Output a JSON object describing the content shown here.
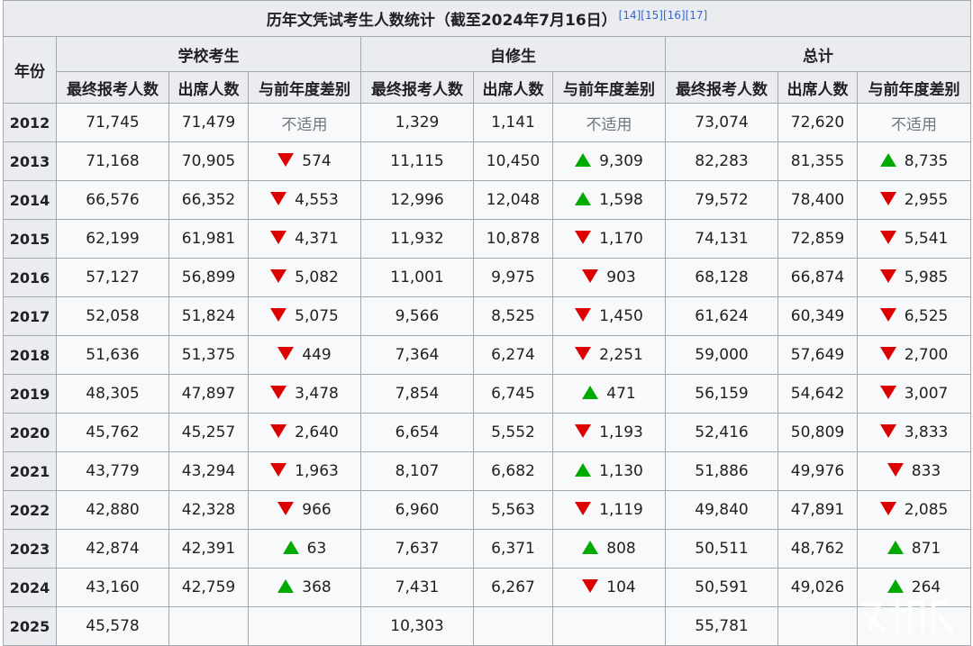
{
  "table": {
    "title": "历年文凭试考生人数统计（截至2024年7月16日）",
    "refs": [
      "[14]",
      "[15]",
      "[16]",
      "[17]"
    ],
    "year_header": "年份",
    "groups": [
      "学校考生",
      "自修生",
      "总计"
    ],
    "subheaders": [
      "最终报考人数",
      "出席人数",
      "与前年度差别"
    ],
    "na_label": "不适用",
    "rows": [
      {
        "year": "2012",
        "cells": [
          {
            "v": "71,745"
          },
          {
            "v": "71,479"
          },
          {
            "na": true
          },
          {
            "v": "1,329"
          },
          {
            "v": "1,141"
          },
          {
            "na": true
          },
          {
            "v": "73,074"
          },
          {
            "v": "72,620"
          },
          {
            "na": true
          }
        ]
      },
      {
        "year": "2013",
        "cells": [
          {
            "v": "71,168"
          },
          {
            "v": "70,905"
          },
          {
            "v": "574",
            "dir": "down"
          },
          {
            "v": "11,115"
          },
          {
            "v": "10,450"
          },
          {
            "v": "9,309",
            "dir": "up"
          },
          {
            "v": "82,283"
          },
          {
            "v": "81,355"
          },
          {
            "v": "8,735",
            "dir": "up"
          }
        ]
      },
      {
        "year": "2014",
        "cells": [
          {
            "v": "66,576"
          },
          {
            "v": "66,352"
          },
          {
            "v": "4,553",
            "dir": "down"
          },
          {
            "v": "12,996"
          },
          {
            "v": "12,048"
          },
          {
            "v": "1,598",
            "dir": "up"
          },
          {
            "v": "79,572"
          },
          {
            "v": "78,400"
          },
          {
            "v": "2,955",
            "dir": "down"
          }
        ]
      },
      {
        "year": "2015",
        "cells": [
          {
            "v": "62,199"
          },
          {
            "v": "61,981"
          },
          {
            "v": "4,371",
            "dir": "down"
          },
          {
            "v": "11,932"
          },
          {
            "v": "10,878"
          },
          {
            "v": "1,170",
            "dir": "down"
          },
          {
            "v": "74,131"
          },
          {
            "v": "72,859"
          },
          {
            "v": "5,541",
            "dir": "down"
          }
        ]
      },
      {
        "year": "2016",
        "cells": [
          {
            "v": "57,127"
          },
          {
            "v": "56,899"
          },
          {
            "v": "5,082",
            "dir": "down"
          },
          {
            "v": "11,001"
          },
          {
            "v": "9,975"
          },
          {
            "v": "903",
            "dir": "down"
          },
          {
            "v": "68,128"
          },
          {
            "v": "66,874"
          },
          {
            "v": "5,985",
            "dir": "down"
          }
        ]
      },
      {
        "year": "2017",
        "cells": [
          {
            "v": "52,058"
          },
          {
            "v": "51,824"
          },
          {
            "v": "5,075",
            "dir": "down"
          },
          {
            "v": "9,566"
          },
          {
            "v": "8,525"
          },
          {
            "v": "1,450",
            "dir": "down"
          },
          {
            "v": "61,624"
          },
          {
            "v": "60,349"
          },
          {
            "v": "6,525",
            "dir": "down"
          }
        ]
      },
      {
        "year": "2018",
        "cells": [
          {
            "v": "51,636"
          },
          {
            "v": "51,375"
          },
          {
            "v": "449",
            "dir": "down"
          },
          {
            "v": "7,364"
          },
          {
            "v": "6,274"
          },
          {
            "v": "2,251",
            "dir": "down"
          },
          {
            "v": "59,000"
          },
          {
            "v": "57,649"
          },
          {
            "v": "2,700",
            "dir": "down"
          }
        ]
      },
      {
        "year": "2019",
        "cells": [
          {
            "v": "48,305"
          },
          {
            "v": "47,897"
          },
          {
            "v": "3,478",
            "dir": "down"
          },
          {
            "v": "7,854"
          },
          {
            "v": "6,745"
          },
          {
            "v": "471",
            "dir": "up"
          },
          {
            "v": "56,159"
          },
          {
            "v": "54,642"
          },
          {
            "v": "3,007",
            "dir": "down"
          }
        ]
      },
      {
        "year": "2020",
        "cells": [
          {
            "v": "45,762"
          },
          {
            "v": "45,257"
          },
          {
            "v": "2,640",
            "dir": "down"
          },
          {
            "v": "6,654"
          },
          {
            "v": "5,552"
          },
          {
            "v": "1,193",
            "dir": "down"
          },
          {
            "v": "52,416"
          },
          {
            "v": "50,809"
          },
          {
            "v": "3,833",
            "dir": "down"
          }
        ]
      },
      {
        "year": "2021",
        "cells": [
          {
            "v": "43,779"
          },
          {
            "v": "43,294"
          },
          {
            "v": "1,963",
            "dir": "down"
          },
          {
            "v": "8,107"
          },
          {
            "v": "6,682"
          },
          {
            "v": "1,130",
            "dir": "up"
          },
          {
            "v": "51,886"
          },
          {
            "v": "49,976"
          },
          {
            "v": "833",
            "dir": "down"
          }
        ]
      },
      {
        "year": "2022",
        "cells": [
          {
            "v": "42,880"
          },
          {
            "v": "42,328"
          },
          {
            "v": "966",
            "dir": "down"
          },
          {
            "v": "6,960"
          },
          {
            "v": "5,563"
          },
          {
            "v": "1,119",
            "dir": "down"
          },
          {
            "v": "49,840"
          },
          {
            "v": "47,891"
          },
          {
            "v": "2,085",
            "dir": "down"
          }
        ]
      },
      {
        "year": "2023",
        "cells": [
          {
            "v": "42,874"
          },
          {
            "v": "42,391"
          },
          {
            "v": "63",
            "dir": "up"
          },
          {
            "v": "7,637"
          },
          {
            "v": "6,371"
          },
          {
            "v": "808",
            "dir": "up"
          },
          {
            "v": "50,511"
          },
          {
            "v": "48,762"
          },
          {
            "v": "871",
            "dir": "up"
          }
        ]
      },
      {
        "year": "2024",
        "cells": [
          {
            "v": "43,160"
          },
          {
            "v": "42,759"
          },
          {
            "v": "368",
            "dir": "up"
          },
          {
            "v": "7,431"
          },
          {
            "v": "6,267"
          },
          {
            "v": "104",
            "dir": "down"
          },
          {
            "v": "50,591"
          },
          {
            "v": "49,026"
          },
          {
            "v": "264",
            "dir": "up"
          }
        ]
      },
      {
        "year": "2025",
        "cells": [
          {
            "v": "45,578"
          },
          {
            "v": ""
          },
          {
            "v": ""
          },
          {
            "v": "10,303"
          },
          {
            "v": ""
          },
          {
            "v": ""
          },
          {
            "v": "55,781"
          },
          {
            "v": ""
          },
          {
            "v": ""
          }
        ]
      }
    ]
  },
  "colors": {
    "down_arrow": "#dd0000",
    "up_arrow": "#00aa00",
    "header_bg": "#eaecf0",
    "cell_bg": "#f8f9fa",
    "border": "#a2a9b1",
    "link": "#3366cc"
  },
  "icons": {
    "decrease": "red-down-triangle-icon",
    "increase": "green-up-triangle-icon"
  }
}
